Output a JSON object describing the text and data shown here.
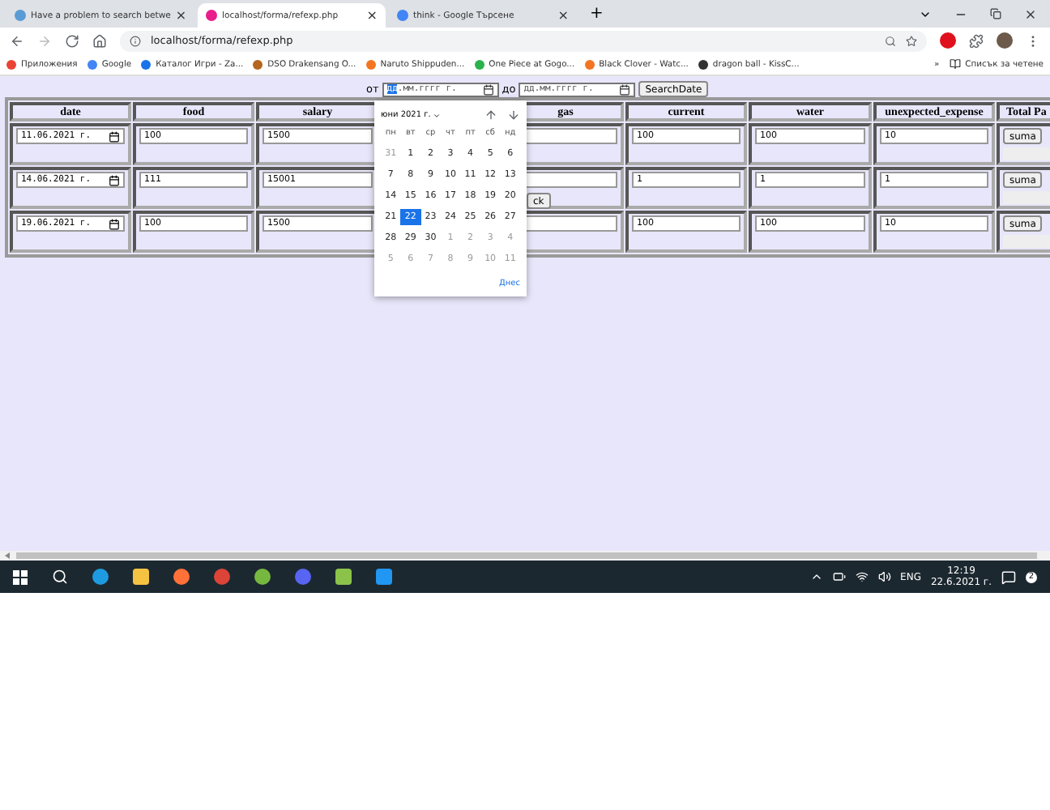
{
  "browser": {
    "tabs": [
      {
        "title": "Have a problem to search betwe",
        "selected": false,
        "close": "×"
      },
      {
        "title": "localhost/forma/refexp.php",
        "selected": true,
        "close": "×"
      },
      {
        "title": "think - Google Търсене",
        "selected": false,
        "close": "×"
      }
    ],
    "new_tab": "+",
    "address": "localhost/forma/refexp.php",
    "bookmarks": [
      {
        "label": "Приложения"
      },
      {
        "label": "Google"
      },
      {
        "label": "Каталог Игри - Za..."
      },
      {
        "label": "DSO Drakensang O..."
      },
      {
        "label": "Naruto Shippuden..."
      },
      {
        "label": "One Piece at Gogo..."
      },
      {
        "label": "Black Clover - Watc..."
      },
      {
        "label": "dragon ball - KissC..."
      }
    ],
    "more_bookmarks": "»",
    "reading_list": "Списък за четене"
  },
  "search": {
    "from_label": "от",
    "from_field": {
      "placeholder": "дд.мм.гггг г.",
      "focused": true
    },
    "to_label": "до",
    "to_field": {
      "placeholder": "дд.мм.гггг г.",
      "focused": false
    },
    "button": "SearchDate"
  },
  "table": {
    "columns": [
      {
        "label": "date"
      },
      {
        "label": "food"
      },
      {
        "label": "salary"
      },
      {},
      {
        "label": "gas"
      },
      {
        "label": "current"
      },
      {
        "label": "water"
      },
      {
        "label": "unexpected_expense"
      },
      {
        "label": "Total Pa"
      }
    ],
    "rows": [
      {
        "cells": [
          {
            "kind": "date",
            "value": "11.06.2021 г."
          },
          {
            "value": "100"
          },
          {
            "value": "1500"
          },
          {},
          {},
          {
            "value": "100"
          },
          {
            "value": "100"
          },
          {
            "value": "10"
          }
        ],
        "button": "suma"
      },
      {
        "cells": [
          {
            "kind": "date",
            "value": "14.06.2021 г."
          },
          {
            "value": "111"
          },
          {
            "value": "15001"
          },
          {},
          {},
          {
            "value": "1"
          },
          {
            "value": "1"
          },
          {
            "value": "1"
          }
        ],
        "button": "suma"
      },
      {
        "cells": [
          {
            "kind": "date",
            "value": "19.06.2021 г."
          },
          {
            "value": "100"
          },
          {
            "value": "1500"
          },
          {},
          {},
          {
            "value": "100"
          },
          {
            "value": "100"
          },
          {
            "value": "10"
          }
        ],
        "button": "suma"
      }
    ]
  },
  "back_button": "ck",
  "calendar": {
    "month": "юни 2021 г.",
    "weekdays": [
      "пн",
      "вт",
      "ср",
      "чт",
      "пт",
      "сб",
      "нд"
    ],
    "weeks": [
      [
        {
          "d": "31",
          "muted": true,
          "selected": false
        },
        {
          "d": "1",
          "muted": false,
          "selected": false
        },
        {
          "d": "2",
          "muted": false,
          "selected": false
        },
        {
          "d": "3",
          "muted": false,
          "selected": false
        },
        {
          "d": "4",
          "muted": false,
          "selected": false
        },
        {
          "d": "5",
          "muted": false,
          "selected": false
        },
        {
          "d": "6",
          "muted": false,
          "selected": false
        }
      ],
      [
        {
          "d": "7",
          "muted": false,
          "selected": false
        },
        {
          "d": "8",
          "muted": false,
          "selected": false
        },
        {
          "d": "9",
          "muted": false,
          "selected": false
        },
        {
          "d": "10",
          "muted": false,
          "selected": false
        },
        {
          "d": "11",
          "muted": false,
          "selected": false
        },
        {
          "d": "12",
          "muted": false,
          "selected": false
        },
        {
          "d": "13",
          "muted": false,
          "selected": false
        }
      ],
      [
        {
          "d": "14",
          "muted": false,
          "selected": false
        },
        {
          "d": "15",
          "muted": false,
          "selected": false
        },
        {
          "d": "16",
          "muted": false,
          "selected": false
        },
        {
          "d": "17",
          "muted": false,
          "selected": false
        },
        {
          "d": "18",
          "muted": false,
          "selected": false
        },
        {
          "d": "19",
          "muted": false,
          "selected": false
        },
        {
          "d": "20",
          "muted": false,
          "selected": false
        }
      ],
      [
        {
          "d": "21",
          "muted": false,
          "selected": false
        },
        {
          "d": "22",
          "muted": false,
          "selected": true
        },
        {
          "d": "23",
          "muted": false,
          "selected": false
        },
        {
          "d": "24",
          "muted": false,
          "selected": false
        },
        {
          "d": "25",
          "muted": false,
          "selected": false
        },
        {
          "d": "26",
          "muted": false,
          "selected": false
        },
        {
          "d": "27",
          "muted": false,
          "selected": false
        }
      ],
      [
        {
          "d": "28",
          "muted": false,
          "selected": false
        },
        {
          "d": "29",
          "muted": false,
          "selected": false
        },
        {
          "d": "30",
          "muted": false,
          "selected": false
        },
        {
          "d": "1",
          "muted": true,
          "selected": false
        },
        {
          "d": "2",
          "muted": true,
          "selected": false
        },
        {
          "d": "3",
          "muted": true,
          "selected": false
        },
        {
          "d": "4",
          "muted": true,
          "selected": false
        }
      ],
      [
        {
          "d": "5",
          "muted": true,
          "selected": false
        },
        {
          "d": "6",
          "muted": true,
          "selected": false
        },
        {
          "d": "7",
          "muted": true,
          "selected": false
        },
        {
          "d": "8",
          "muted": true,
          "selected": false
        },
        {
          "d": "9",
          "muted": true,
          "selected": false
        },
        {
          "d": "10",
          "muted": true,
          "selected": false
        },
        {
          "d": "11",
          "muted": true,
          "selected": false
        }
      ]
    ],
    "today": "Днес"
  },
  "taskbar": {
    "language": "ENG",
    "time": "12:19",
    "date": "22.6.2021 г.",
    "notifications": "2"
  }
}
